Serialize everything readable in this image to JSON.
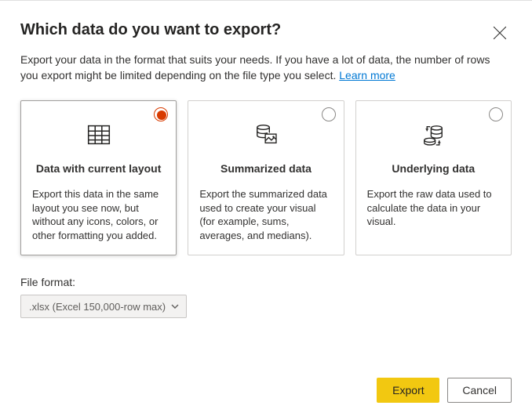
{
  "title": "Which data do you want to export?",
  "description_part1": "Export your data in the format that suits your needs. If you have a lot of data, the number of rows you export might be limited depending on the file type you select. ",
  "learn_more": "Learn more",
  "cards": [
    {
      "title": "Data with current layout",
      "desc": "Export this data in the same layout you see now, but without any icons, colors, or other formatting you added."
    },
    {
      "title": "Summarized data",
      "desc": "Export the summarized data used to create your visual (for example, sums, averages, and medians)."
    },
    {
      "title": "Underlying data",
      "desc": "Export the raw data used to calculate the data in your visual."
    }
  ],
  "file_format_label": "File format:",
  "file_format_value": ".xlsx (Excel 150,000-row max)",
  "buttons": {
    "export": "Export",
    "cancel": "Cancel"
  }
}
